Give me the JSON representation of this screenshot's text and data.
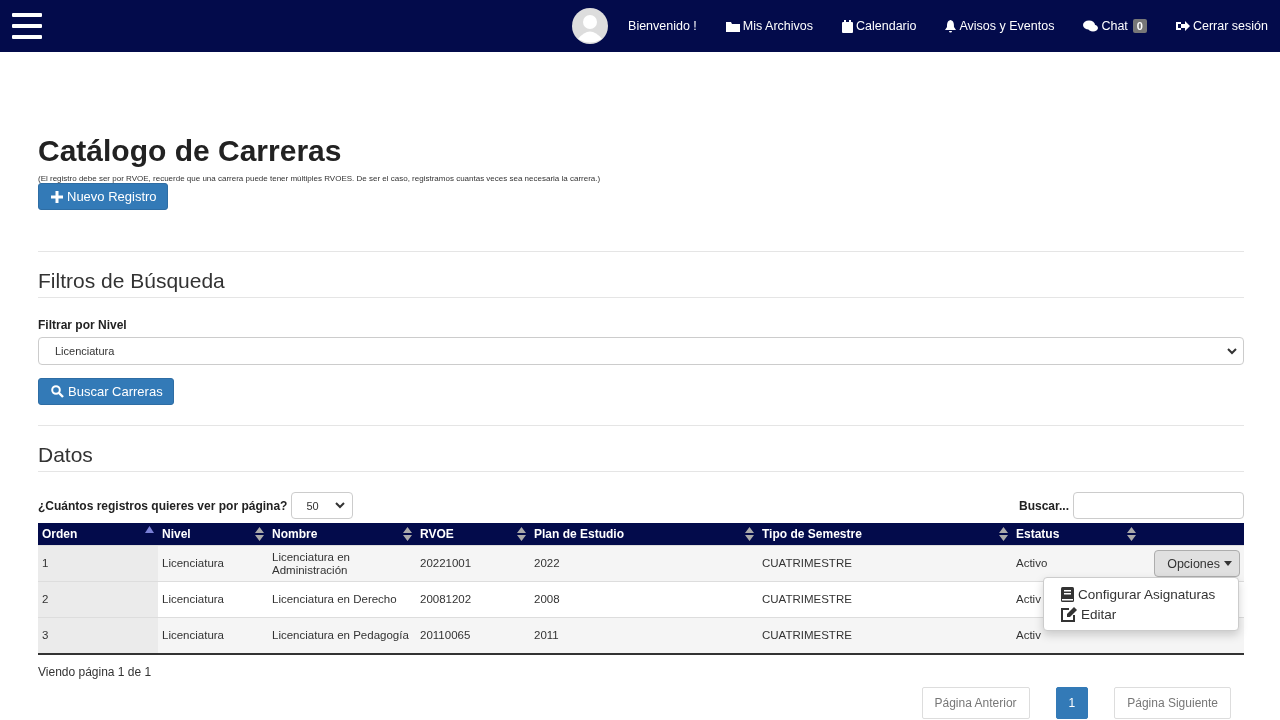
{
  "navbar": {
    "items": [
      {
        "kind": "greeting",
        "label": "Bienvenido !"
      },
      {
        "kind": "folder",
        "label": "Mis Archivos"
      },
      {
        "kind": "calendar",
        "label": "Calendario"
      },
      {
        "kind": "bell",
        "label": "Avisos y Eventos"
      },
      {
        "kind": "chat",
        "label": "Chat",
        "badge": "0"
      },
      {
        "kind": "logout",
        "label": "Cerrar sesión"
      }
    ]
  },
  "title": "Catálogo de Carreras",
  "note": "(El registro debe ser por RVOE, recuerde que una carrera puede tener múltiples RVOES. De ser el caso, registramos cuantas veces sea necesaria la carrera.)",
  "new_button": "Nuevo Registro",
  "filters": {
    "heading": "Filtros de Búsqueda",
    "label": "Filtrar por Nivel",
    "value": "Licenciatura",
    "button": "Buscar Carreras"
  },
  "data": {
    "heading": "Datos",
    "per_page_label": "¿Cuántos registros quieres ver por página?",
    "per_page": "50",
    "search_label": "Buscar...",
    "columns": [
      {
        "label": "Orden",
        "sorted": true
      },
      {
        "label": "Nivel",
        "sorted": false
      },
      {
        "label": "Nombre",
        "sorted": false
      },
      {
        "label": "RVOE",
        "sorted": false
      },
      {
        "label": "Plan de Estudio",
        "sorted": false
      },
      {
        "label": "Tipo de Semestre",
        "sorted": false
      },
      {
        "label": "Estatus",
        "sorted": false
      }
    ],
    "rows": [
      {
        "cells": [
          "1",
          "Licenciatura",
          "Licenciatura en Administración",
          "20221001",
          "2022",
          "CUATRIMESTRE",
          "Activo"
        ],
        "options": "Opciones"
      },
      {
        "cells": [
          "2",
          "Licenciatura",
          "Licenciatura en Derecho",
          "20081202",
          "2008",
          "CUATRIMESTRE",
          "Activ"
        ]
      },
      {
        "cells": [
          "3",
          "Licenciatura",
          "Licenciatura en Pedagogía",
          "20110065",
          "2011",
          "CUATRIMESTRE",
          "Activ"
        ]
      }
    ],
    "menu": [
      {
        "kind": "book",
        "label": "Configurar Asignaturas"
      },
      {
        "kind": "edit",
        "label": "Editar"
      }
    ],
    "page_info": "Viendo página 1 de 1",
    "pagination": [
      {
        "label": "Página Anterior",
        "selected": false
      },
      {
        "label": "1",
        "selected": true
      },
      {
        "label": "Página Siguiente",
        "selected": false
      }
    ]
  }
}
